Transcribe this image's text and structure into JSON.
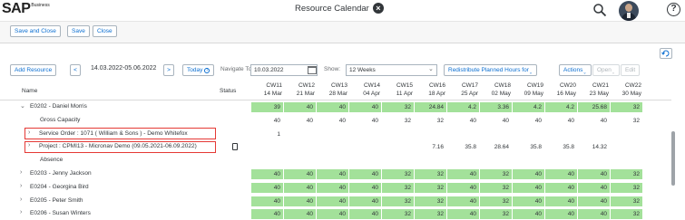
{
  "shell": {
    "brand": "SAP",
    "brand_sup": "Business",
    "title": "Resource Calendar"
  },
  "top_buttons": [
    "Save and Close",
    "Save",
    "Close"
  ],
  "toolbar": {
    "add_resource": "Add Resource",
    "prev": "<",
    "date_range": "14.03.2022-05.06.2022",
    "next": ">",
    "today": "Today",
    "navigate_label": "Navigate To:",
    "navigate_value": "10.03.2022",
    "show_label": "Show:",
    "show_value": "12 Weeks",
    "redistribute": "Redistribute Planned Hours for",
    "actions": "Actions",
    "open": "Open",
    "edit": "Edit"
  },
  "table": {
    "name_header": "Name",
    "status_header": "Status",
    "columns": [
      {
        "cw": "CW11",
        "date": "14 Mar"
      },
      {
        "cw": "CW12",
        "date": "21 Mar"
      },
      {
        "cw": "CW13",
        "date": "28 Mar"
      },
      {
        "cw": "CW14",
        "date": "04 Apr"
      },
      {
        "cw": "CW15",
        "date": "11 Apr"
      },
      {
        "cw": "CW16",
        "date": "18 Apr"
      },
      {
        "cw": "CW17",
        "date": "25 Apr"
      },
      {
        "cw": "CW18",
        "date": "02 May"
      },
      {
        "cw": "CW19",
        "date": "09 May"
      },
      {
        "cw": "CW20",
        "date": "16 May"
      },
      {
        "cw": "CW21",
        "date": "23 May"
      },
      {
        "cw": "CW22",
        "date": "30 May"
      }
    ],
    "rows": [
      {
        "label": "E0202 - Daniel Morris",
        "chevron": "v",
        "indent": 0,
        "green": true,
        "values": [
          "39",
          "40",
          "40",
          "40",
          "32",
          "24.84",
          "4.2",
          "3.36",
          "4.2",
          "4.2",
          "25.68",
          "32"
        ]
      },
      {
        "label": "Gross Capacity",
        "chevron": "",
        "indent": 1,
        "green": false,
        "values": [
          "40",
          "40",
          "40",
          "40",
          "32",
          "32",
          "40",
          "40",
          "40",
          "40",
          "40",
          "32"
        ]
      },
      {
        "label": "Service Order : 1071 ( William & Sons ) - Demo Whitefox",
        "chevron": ">",
        "indent": 1,
        "green": false,
        "values": [
          "1",
          "",
          "",
          "",
          "",
          "",
          "",
          "",
          "",
          "",
          "",
          ""
        ]
      },
      {
        "label": "Project : CPMI13 - Micronav Demo (09.05.2021-06.09.2022)",
        "chevron": ">",
        "indent": 1,
        "green": false,
        "status_icon": true,
        "values": [
          "",
          "",
          "",
          "",
          "",
          "7.16",
          "35.8",
          "28.64",
          "35.8",
          "35.8",
          "14.32",
          ""
        ]
      },
      {
        "label": "Absence",
        "chevron": "",
        "indent": 1,
        "green": false,
        "values": [
          "",
          "",
          "",
          "",
          "",
          "",
          "",
          "",
          "",
          "",
          "",
          ""
        ]
      },
      {
        "label": "E0203 - Jenny Jackson",
        "chevron": ">",
        "indent": 0,
        "green": true,
        "values": [
          "40",
          "40",
          "40",
          "40",
          "32",
          "32",
          "40",
          "32",
          "40",
          "40",
          "40",
          "32"
        ]
      },
      {
        "label": "E0204 - Georgina Bird",
        "chevron": ">",
        "indent": 0,
        "green": true,
        "values": [
          "40",
          "40",
          "40",
          "40",
          "32",
          "32",
          "40",
          "32",
          "40",
          "40",
          "40",
          "32"
        ]
      },
      {
        "label": "E0205 - Peter Smith",
        "chevron": ">",
        "indent": 0,
        "green": true,
        "values": [
          "40",
          "40",
          "40",
          "40",
          "32",
          "32",
          "40",
          "32",
          "40",
          "40",
          "40",
          "32"
        ]
      },
      {
        "label": "E0206 - Susan Winters",
        "chevron": ">",
        "indent": 0,
        "green": true,
        "values": [
          "40",
          "40",
          "40",
          "40",
          "32",
          "32",
          "40",
          "32",
          "40",
          "40",
          "40",
          "32"
        ]
      }
    ]
  }
}
